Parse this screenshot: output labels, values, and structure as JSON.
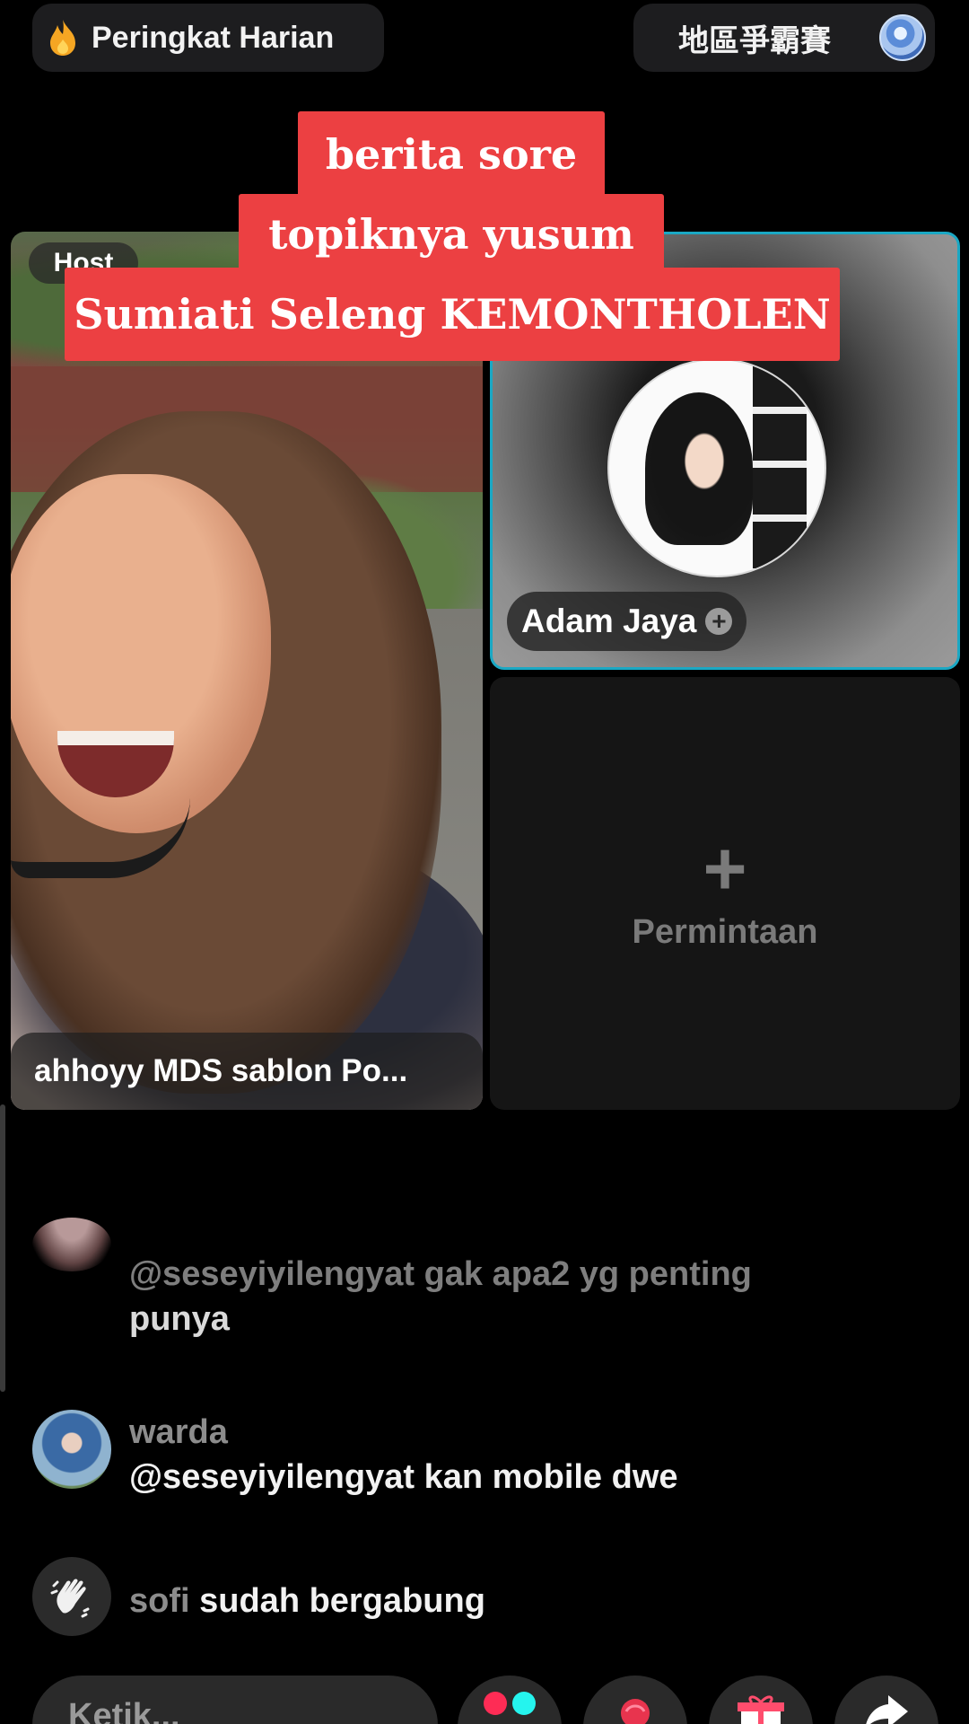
{
  "top_bar": {
    "left_pill": {
      "icon": "flame-icon",
      "label": "Peringkat Harian"
    },
    "right_pill": {
      "label": "地區爭霸賽",
      "icon": "region-badge-icon"
    }
  },
  "title_banners": [
    "berita sore",
    "topiknya yusum",
    "Sumiati Seleng KEMONTHOLEN"
  ],
  "host_tile": {
    "tag": "Host",
    "name": "ahhoyy MDS sablon Po..."
  },
  "guest_tile": {
    "name": "Adam Jaya",
    "follow_icon": "+",
    "active_border_color": "#1aa8c4"
  },
  "request_tile": {
    "plus": "+",
    "label": "Permintaan"
  },
  "chat": [
    {
      "user": "",
      "text_line1": "@seseyiyilengyat gak apa2 yg penting",
      "text_line2": "punya"
    },
    {
      "user": "warda",
      "text": "@seseyiyilengyat kan mobile dwe"
    },
    {
      "user": "sofi",
      "text": "sudah bergabung",
      "icon": "wave-hand-icon"
    }
  ],
  "bottom_bar": {
    "input_placeholder": "Ketik...",
    "buttons": [
      "multi-guest-icon",
      "rose-gift-icon",
      "gift-icon",
      "share-icon"
    ]
  },
  "colors": {
    "banner": "#ec4042",
    "background": "#000000"
  }
}
